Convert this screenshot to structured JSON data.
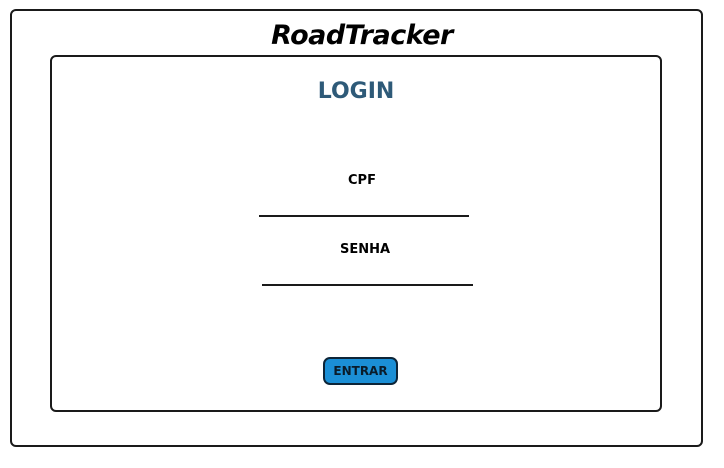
{
  "app": {
    "title": "RoadTracker"
  },
  "login": {
    "title": "LOGIN",
    "cpf_label": "CPF",
    "cpf_value": "",
    "senha_label": "SENHA",
    "senha_value": "",
    "submit_label": "ENTRAR"
  },
  "colors": {
    "title_color": "#2e5a78",
    "button_color": "#1b8fd6",
    "border_color": "#1a1a1a"
  }
}
